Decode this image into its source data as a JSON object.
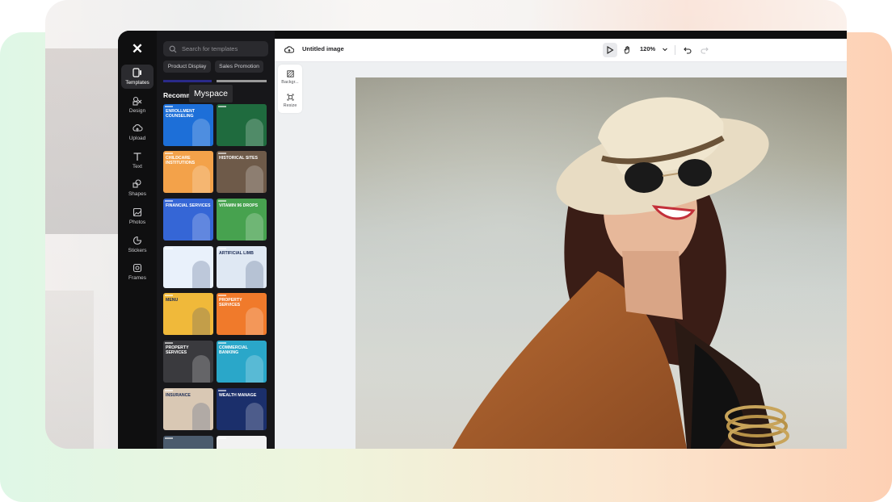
{
  "app": {
    "logo": "✕"
  },
  "rail": {
    "items": [
      {
        "label": "Templates",
        "icon": "templates-icon",
        "active": true
      },
      {
        "label": "Design",
        "icon": "design-icon"
      },
      {
        "label": "Upload",
        "icon": "upload-icon"
      },
      {
        "label": "Text",
        "icon": "text-icon"
      },
      {
        "label": "Shapes",
        "icon": "shapes-icon"
      },
      {
        "label": "Photos",
        "icon": "photos-icon"
      },
      {
        "label": "Stickers",
        "icon": "stickers-icon"
      },
      {
        "label": "Frames",
        "icon": "frames-icon"
      }
    ]
  },
  "panel": {
    "search_placeholder": "Search for templates",
    "chips": [
      "Product Display",
      "Sales Promotion"
    ],
    "section_title": "Recomm",
    "tooltip": "Myspace",
    "templates": [
      {
        "text": "ENROLLMENT COUNSELING",
        "bg": "#1d6fd8"
      },
      {
        "text": "",
        "bg": "#1f6b3e"
      },
      {
        "text": "CHILDCARE INSTITUTIONS",
        "bg": "#f3a24a"
      },
      {
        "text": "Historical Sites",
        "bg": "#6e5a49"
      },
      {
        "text": "FINANCIAL SERVICES",
        "bg": "#3566d6"
      },
      {
        "text": "Vitamin 96 Drops",
        "bg": "#47a24f"
      },
      {
        "text": "",
        "bg": "#e9f1fb"
      },
      {
        "text": "Artificial limb",
        "bg": "#dfe8f3"
      },
      {
        "text": "Menu",
        "bg": "#f0b93a"
      },
      {
        "text": "PROPERTY SERVICES",
        "bg": "#f07a2b"
      },
      {
        "text": "PROPERTY SERVICES",
        "bg": "#3a3a3e"
      },
      {
        "text": "COMMERCIAL BANKING",
        "bg": "#2aa7c9"
      },
      {
        "text": "INSURANCE",
        "bg": "#d9c8b4"
      },
      {
        "text": "Wealth Manage",
        "bg": "#1b2f6b"
      },
      {
        "text": "",
        "bg": "#4b5b6d"
      },
      {
        "text": "",
        "bg": "#f2f2f2"
      }
    ]
  },
  "editor": {
    "title": "Untitled image",
    "zoom": "120%",
    "side_tools": [
      "Backgr...",
      "Resize"
    ]
  },
  "colors": {
    "app_bg": "#0f0f10",
    "panel_bg": "#17171a",
    "canvas_bg": "#eef0f2"
  }
}
